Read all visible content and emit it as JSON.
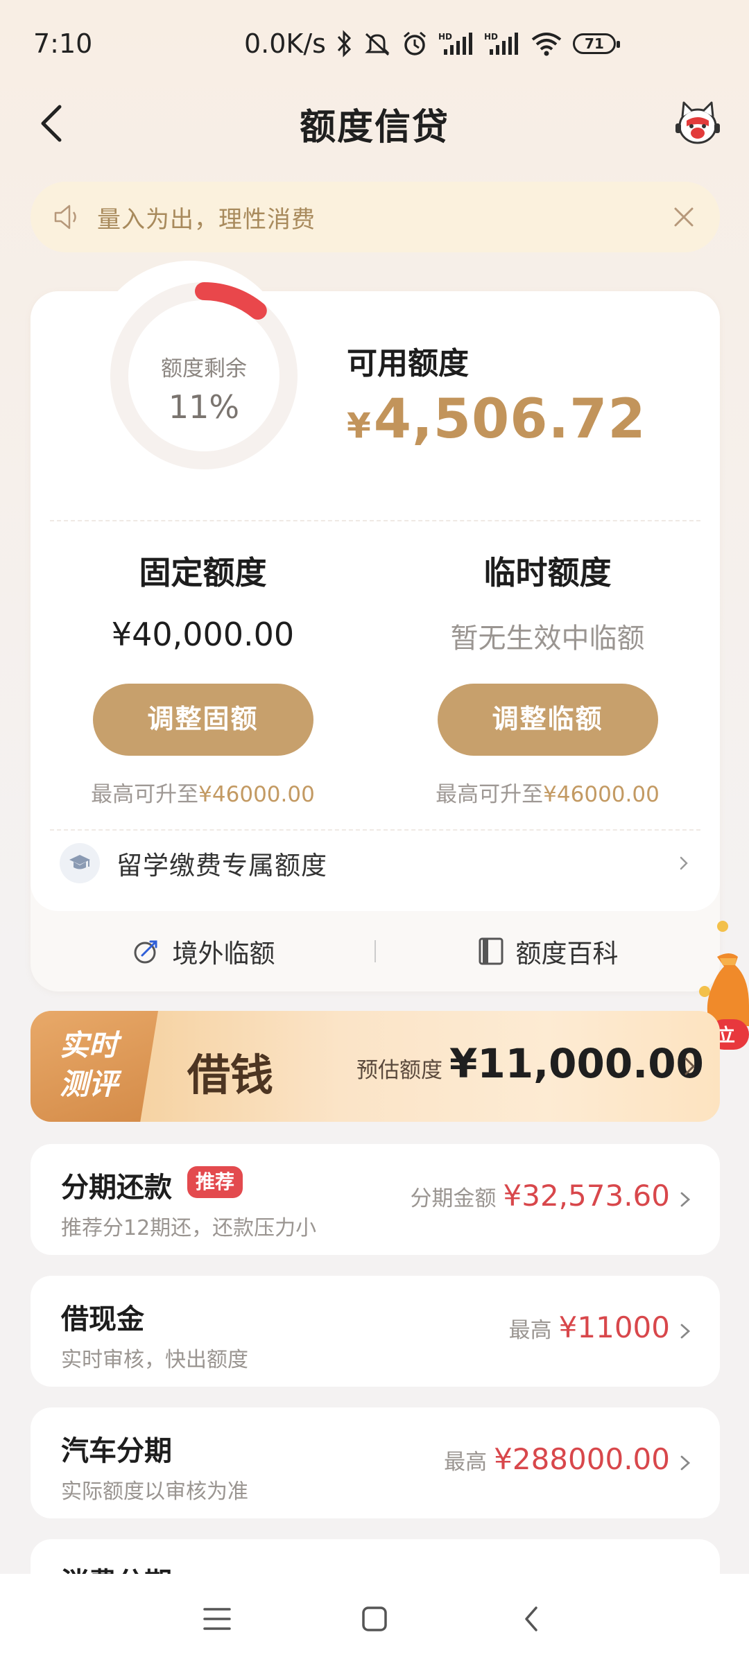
{
  "status_bar": {
    "time": "7:10",
    "network_speed": "0.0K/s",
    "battery": "71",
    "icons": [
      "bluetooth-icon",
      "mute-icon",
      "alarm-icon",
      "hd-signal-icon",
      "hd-signal-icon",
      "wifi-icon",
      "battery-icon"
    ]
  },
  "header": {
    "title": "额度信贷",
    "back_icon": "chevron-left-icon",
    "mascot_icon": "mascot-icon"
  },
  "notice": {
    "text": "量入为出，理性消费",
    "icon": "speaker-icon",
    "close_icon": "close-icon"
  },
  "credit": {
    "ring_label": "额度剩余",
    "ring_percent": "11%",
    "ring_fraction": 0.11,
    "available_label": "可用额度",
    "available_currency": "¥",
    "available_amount": "4,506.72",
    "fixed": {
      "title": "固定额度",
      "value": "¥40,000.00",
      "button": "调整固额",
      "max_prefix": "最高可升至",
      "max_value": "¥46000.00"
    },
    "temp": {
      "title": "临时额度",
      "value": "暂无生效中临额",
      "button": "调整临额",
      "max_prefix": "最高可升至",
      "max_value": "¥46000.00"
    },
    "study_label": "留学缴费专属额度",
    "links": {
      "overseas": "境外临额",
      "wiki": "额度百科"
    }
  },
  "borrow_banner": {
    "badge_line1": "实时",
    "badge_line2": "测评",
    "title": "借钱",
    "est_label": "预估额度",
    "amount": "¥11,000.00"
  },
  "loans": [
    {
      "title": "分期还款",
      "tag": "推荐",
      "subtitle": "推荐分12期还，还款压力小",
      "prefix": "分期金额",
      "amount": "¥32,573.60"
    },
    {
      "title": "借现金",
      "subtitle": "实时审核，快出额度",
      "prefix": "最高",
      "amount": "¥11000"
    },
    {
      "title": "汽车分期",
      "subtitle": "实际额度以审核为准",
      "prefix": "最高",
      "amount": "¥288000.00"
    },
    {
      "title": "消费分期"
    }
  ],
  "colors": {
    "accent_gold": "#c2945b",
    "button_gold": "#c7a06c",
    "ring_red": "#e9474b",
    "amount_red": "#d8474b",
    "tag_red": "#e34a4e"
  },
  "nav": {
    "icons": [
      "menu-icon",
      "home-square-icon",
      "back-triangle-icon"
    ]
  }
}
